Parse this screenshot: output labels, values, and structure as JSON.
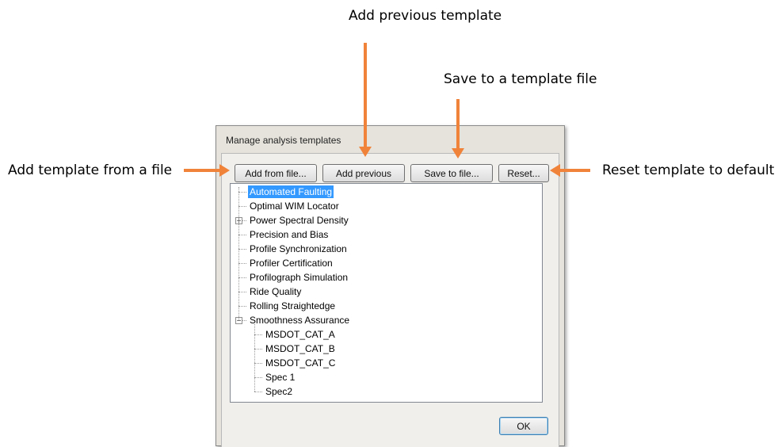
{
  "callouts": {
    "add_previous": "Add previous template",
    "save_to_file": "Save to a template file",
    "add_from_file": "Add template from a file",
    "reset": "Reset template to default"
  },
  "dialog": {
    "title": "Manage analysis templates",
    "buttons": {
      "add_from_file": "Add from file...",
      "add_previous": "Add previous",
      "save_to_file": "Save to file...",
      "reset": "Reset...",
      "ok": "OK"
    },
    "tree": {
      "items": [
        {
          "label": "Automated Faulting",
          "selected": true
        },
        {
          "label": "Optimal WIM Locator"
        },
        {
          "label": "Power Spectral Density",
          "expander": "+"
        },
        {
          "label": "Precision and Bias"
        },
        {
          "label": "Profile Synchronization"
        },
        {
          "label": "Profiler Certification"
        },
        {
          "label": "Profilograph Simulation"
        },
        {
          "label": "Ride Quality"
        },
        {
          "label": "Rolling Straightedge"
        },
        {
          "label": "Smoothness Assurance",
          "expander": "−",
          "children": [
            {
              "label": "MSDOT_CAT_A"
            },
            {
              "label": "MSDOT_CAT_B"
            },
            {
              "label": "MSDOT_CAT_C"
            },
            {
              "label": "Spec 1"
            },
            {
              "label": "Spec2"
            }
          ]
        }
      ]
    }
  },
  "colors": {
    "arrow": "#f0833a",
    "selection": "#3399ff"
  }
}
